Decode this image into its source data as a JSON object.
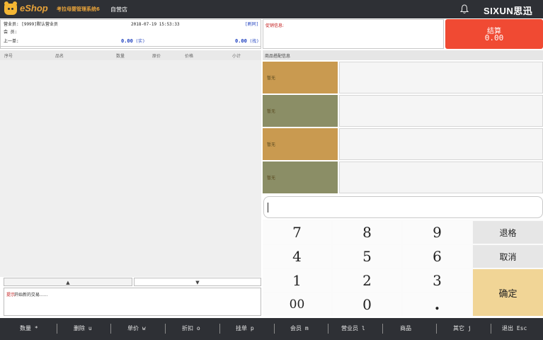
{
  "topbar": {
    "brand": "eShop",
    "brand_subtitle": "考拉母婴管理系统6",
    "store": "自营店",
    "logo_text": "SIXUN思迅",
    "icons": {
      "notification": "bell-icon",
      "logo": "bear-logo-icon"
    }
  },
  "session": {
    "operator": "营业员: [9999]默认营业员",
    "datetime": "2018-07-19 15:53:33",
    "refresh_label": "[刷同]",
    "member": "会  员:",
    "last_order_label": "上一单:",
    "last_paid": "0.00",
    "last_paid_unit": "(实)",
    "last_change": "0.00",
    "last_change_unit": "(找)"
  },
  "promo": {
    "label": "促销信息:"
  },
  "checkout": {
    "label": "结算",
    "amount": "0.00"
  },
  "table": {
    "columns": [
      "序号",
      "品名",
      "数量",
      "原价",
      "价格",
      "小计"
    ],
    "rows": []
  },
  "pager": {
    "up": "▲",
    "down": "▼"
  },
  "tip": {
    "label": "提示:",
    "message": "开始新的交易......"
  },
  "matching": {
    "title": "商品搭配信息",
    "cards": [
      {
        "label": "暂无",
        "color": "#c99a50"
      },
      {
        "label": "暂无",
        "color": "#8b8e66"
      },
      {
        "label": "暂无",
        "color": "#c99a50"
      },
      {
        "label": "暂无",
        "color": "#8b8e66"
      }
    ]
  },
  "input": {
    "value": ""
  },
  "keypad": {
    "keys": [
      "7",
      "8",
      "9",
      "4",
      "5",
      "6",
      "1",
      "2",
      "3",
      "00",
      "0",
      "."
    ],
    "backspace": "退格",
    "cancel": "取消",
    "confirm": "确定"
  },
  "bottombar": {
    "items": [
      "数量 *",
      "删除 u",
      "单价 w",
      "折扣 o",
      "挂单 p",
      "会员 m",
      "营业员 l",
      "商品",
      "其它 j",
      "退出 Esc"
    ]
  },
  "colors": {
    "topbar": "#2e3035",
    "checkout": "#f04a33",
    "confirm": "#f1d596",
    "accent": "#1d3fbf"
  }
}
